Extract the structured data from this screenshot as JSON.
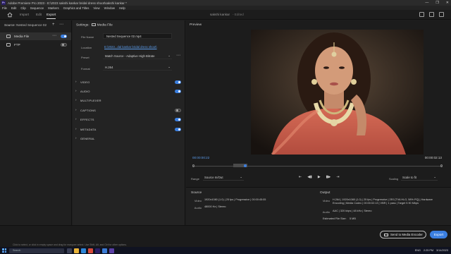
{
  "window": {
    "title": "Adobe Premiere Pro 2023 - E:\\2023 sakshi kankar bridal dress shoot\\sakshi kankar *",
    "controls": [
      "—",
      "❐",
      "✕"
    ]
  },
  "menu": [
    "File",
    "Edit",
    "Clip",
    "Sequence",
    "Markers",
    "Graphics and Titles",
    "View",
    "Window",
    "Help"
  ],
  "nav": {
    "tabs": [
      "Import",
      "Edit",
      "Export"
    ],
    "active_tab": "Export",
    "project_name": "sakshi kankar",
    "project_status": "- Edited"
  },
  "left_panel": {
    "source_label": "Source:",
    "source_value": "Nested Sequence 02",
    "destinations": [
      {
        "label": "Media File",
        "enabled": true,
        "selected": true
      },
      {
        "label": "FTP",
        "enabled": false,
        "selected": false
      }
    ]
  },
  "settings": {
    "header_label": "Settings:",
    "header_value": "Media File",
    "file_name_label": "File Name",
    "file_name_value": "Nested Sequence 02.mp4",
    "location_label": "Location",
    "location_value": "E:\\2023...dal kankar bridal dress shoot\\",
    "preset_label": "Preset",
    "preset_value": "Match Source - Adaptive High Bitrate",
    "format_label": "Format",
    "format_value": "H.264",
    "sections": [
      {
        "name": "VIDEO",
        "enabled": true
      },
      {
        "name": "AUDIO",
        "enabled": true
      },
      {
        "name": "MULTIPLEXER",
        "enabled": null
      },
      {
        "name": "CAPTIONS",
        "enabled": false
      },
      {
        "name": "EFFECTS",
        "enabled": true
      },
      {
        "name": "METADATA",
        "enabled": true
      },
      {
        "name": "GENERAL",
        "enabled": null
      }
    ]
  },
  "preview": {
    "header": "Preview",
    "timecode_current": "00:00:00:22",
    "timecode_end": "00:00:02:13",
    "playhead_fraction": 0.21,
    "range_label": "Range",
    "range_value": "Source In/Out",
    "scaling_label": "Scaling",
    "scaling_value": "Scale to fit"
  },
  "summary": {
    "source_title": "Source",
    "source_video_key": "Video",
    "source_video_val": "1920x1080 (1.0) | 25 fps | Progressive | 00:00:45:05",
    "source_audio_key": "Audio",
    "source_audio_val": "48000 Hz | Stereo",
    "output_title": "Output",
    "output_video_key": "Video",
    "output_video_val1": "H.264 | 1920x1080 (1.0) | 25 fps | Progressive | 2E0 [TVA HLG, 58% PQ] | Hardware",
    "output_video_val2": "Encoding | Media Codec | 00:00:02:13 | VBR | 1 pass | Target 9.90 Mbps",
    "output_audio_key": "Audio",
    "output_audio_val": "AAC | 320 kbps | 48 kHz | Stereo",
    "filesize_label": "Estimated File Size:",
    "filesize_value": "5 MB"
  },
  "footer": {
    "ame_button": "Send to Media Encoder",
    "export_button": "Export",
    "hint": "Click to select, or click in empty space and drag for marquee select. Use Shift, Alt, and Ctrl for other options."
  },
  "taskbar": {
    "search_placeholder": "Search",
    "temp": "ENG",
    "time": "2:25 PM",
    "date": "3/14/2023"
  },
  "colors": {
    "accent": "#3b7fe0",
    "link": "#5a9bea"
  }
}
